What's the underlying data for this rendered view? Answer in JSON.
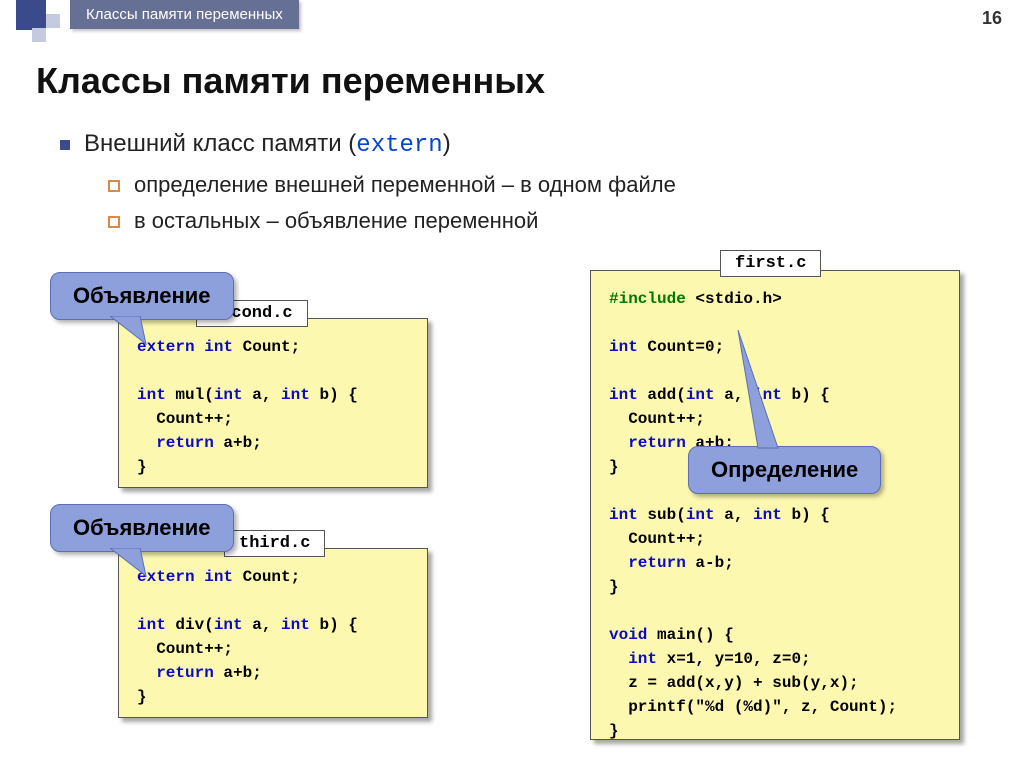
{
  "page_number": "16",
  "breadcrumb": "Классы памяти переменных",
  "title": "Классы памяти переменных",
  "bullet1_pre": "Внешний класс памяти (",
  "bullet1_kw": "extern",
  "bullet1_post": ")",
  "sub1": "определение внешней переменной – в одном файле",
  "sub2": "в остальных – объявление переменной",
  "files": {
    "first": {
      "name": "first.c"
    },
    "second": {
      "name": "second.c"
    },
    "third": {
      "name": "third.c"
    }
  },
  "callouts": {
    "decl1": "Объявление",
    "decl2": "Объявление",
    "def": "Определение"
  },
  "code": {
    "second": {
      "l1a": "extern",
      "l1b": " int",
      "l1c": " Count;",
      "l2a": "int",
      "l2b": " mul(",
      "l2c": "int",
      "l2d": " a, ",
      "l2e": "int",
      "l2f": " b) {",
      "l3": "  Count++;",
      "l4a": "  return",
      "l4b": " a+b;",
      "l5": "}"
    },
    "third": {
      "l1a": "extern",
      "l1b": " int",
      "l1c": " Count;",
      "l2a": "int",
      "l2b": " div(",
      "l2c": "int",
      "l2d": " a, ",
      "l2e": "int",
      "l2f": " b) {",
      "l3": "  Count++;",
      "l4a": "  return",
      "l4b": " a+b;",
      "l5": "}"
    },
    "first": {
      "inc_a": "#include",
      "inc_b": " <stdio.h>",
      "c0a": "int",
      "c0b": " Count=0;",
      "add_a": "int",
      "add_b": " add(",
      "add_c": "int",
      "add_d": " a, ",
      "add_e": "int",
      "add_f": " b) {",
      "add_l2": "  Count++;",
      "add_l3a": "  return",
      "add_l3b": " a+b;",
      "add_l4": "}",
      "sub_a": "int",
      "sub_b": " sub(",
      "sub_c": "int",
      "sub_d": " a, ",
      "sub_e": "int",
      "sub_f": " b) {",
      "sub_l2": "  Count++;",
      "sub_l3a": "  return",
      "sub_l3b": " a-b;",
      "sub_l4": "}",
      "main_a": "void",
      "main_b": " main() {",
      "main_l2a": "  int",
      "main_l2b": " x=1, y=10, z=0;",
      "main_l3": "  z = add(x,y) + sub(y,x);",
      "main_l4": "  printf(\"%d (%d)\", z, Count);",
      "main_l5": "}"
    }
  }
}
